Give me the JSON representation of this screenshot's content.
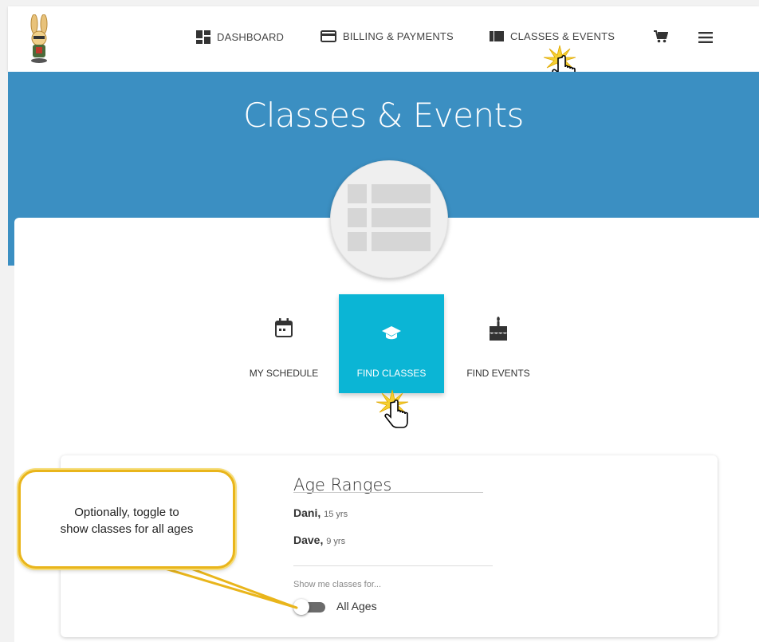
{
  "header": {
    "nav": [
      {
        "label": "DASHBOARD",
        "icon": "dashboard-icon"
      },
      {
        "label": "BILLING & PAYMENTS",
        "icon": "credit-card-icon"
      },
      {
        "label": "CLASSES & EVENTS",
        "icon": "book-icon"
      }
    ],
    "cart_icon": "cart-icon",
    "menu_icon": "hamburger-menu-icon"
  },
  "hero": {
    "title": "Classes & Events"
  },
  "tabs": [
    {
      "label": "MY SCHEDULE",
      "icon": "calendar-icon",
      "active": false
    },
    {
      "label": "FIND CLASSES",
      "icon": "graduation-cap-icon",
      "active": true
    },
    {
      "label": "FIND EVENTS",
      "icon": "birthday-cake-icon",
      "active": false
    }
  ],
  "age_ranges": {
    "title": "Age Ranges",
    "people": [
      {
        "name": "Dani,",
        "age": "15 yrs"
      },
      {
        "name": "Dave,",
        "age": "9 yrs"
      }
    ],
    "show_label": "Show me classes for...",
    "toggle_label": "All Ages",
    "toggle_on": false
  },
  "callout": {
    "line1": "Optionally, toggle to",
    "line2": "show classes for all ages"
  },
  "colors": {
    "hero_blue": "#3b8fc2",
    "active_tab": "#0bb5d5",
    "callout_border": "#e9b51b"
  }
}
